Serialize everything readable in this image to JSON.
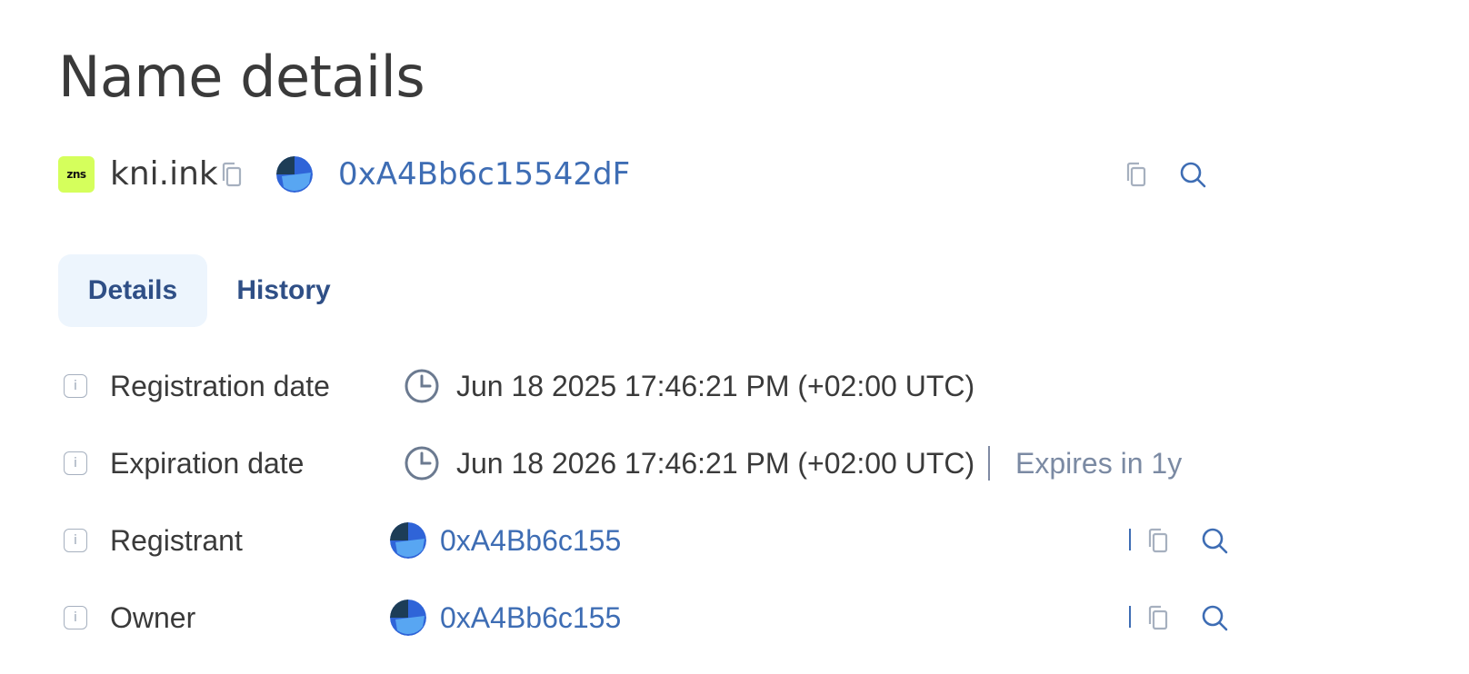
{
  "page": {
    "title": "Name details"
  },
  "name": {
    "domain": "kni.ink",
    "logo_text": "zns",
    "logo_color": "#d5ff5c",
    "address": "0xA4Bb6c15542dF"
  },
  "tabs": [
    {
      "label": "Details",
      "active": true
    },
    {
      "label": "History",
      "active": false
    }
  ],
  "details": {
    "registration": {
      "label": "Registration date",
      "value": "Jun 18 2025 17:46:21 PM (+02:00 UTC)"
    },
    "expiration": {
      "label": "Expiration date",
      "value": "Jun 18 2026 17:46:21 PM (+02:00 UTC)",
      "note": "Expires in 1y"
    },
    "registrant": {
      "label": "Registrant",
      "address": "0xA4Bb6c155"
    },
    "owner": {
      "label": "Owner",
      "address": "0xA4Bb6c155"
    }
  },
  "icons": {
    "info": "info-icon",
    "clock": "clock-icon",
    "copy": "copy-icon",
    "search": "search-icon",
    "avatar": "avatar-icon"
  },
  "colors": {
    "link": "#3e6db4",
    "tab_active_bg": "#edf5fd",
    "icon_gray": "#9aa5b6"
  }
}
